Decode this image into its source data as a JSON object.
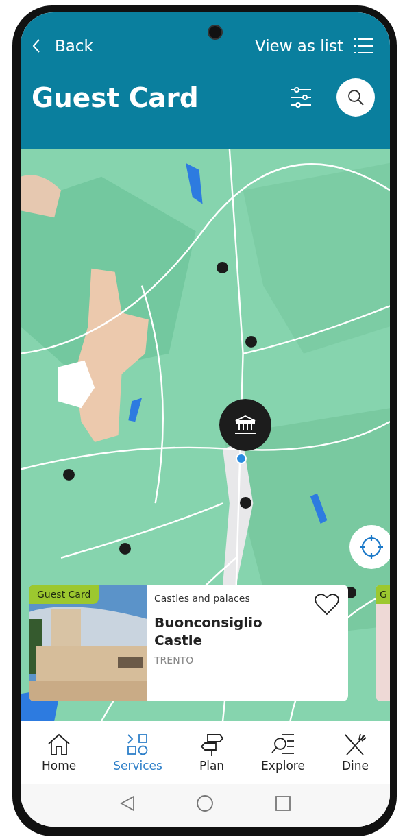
{
  "header": {
    "back_label": "Back",
    "view_toggle_label": "View as list",
    "title": "Guest Card"
  },
  "cards": [
    {
      "kind": "full",
      "badge": "Guest Card",
      "category": "Castles and palaces",
      "name": "Buonconsiglio Castle",
      "city": "TRENTO",
      "favorite": false
    },
    {
      "kind": "peek",
      "badge": "G"
    }
  ],
  "tab_bar": [
    {
      "kind": "home",
      "label": "Home",
      "selected": false
    },
    {
      "kind": "services",
      "label": "Services",
      "selected": true
    },
    {
      "kind": "plan",
      "label": "Plan",
      "selected": false
    },
    {
      "kind": "explore",
      "label": "Explore",
      "selected": false
    },
    {
      "kind": "dine",
      "label": "Dine",
      "selected": false
    }
  ]
}
